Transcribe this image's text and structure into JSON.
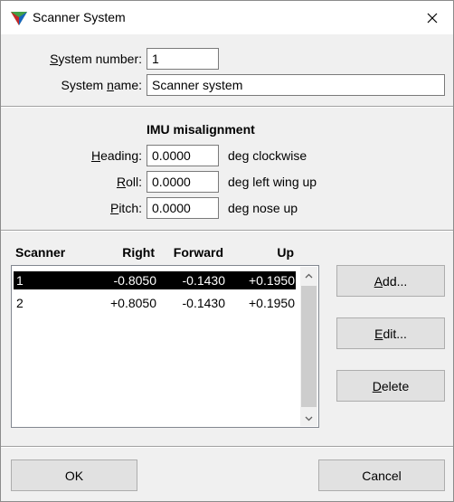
{
  "window": {
    "title": "Scanner System"
  },
  "system": {
    "number_label_pre": "",
    "number_label_u": "S",
    "number_label_post": "ystem number:",
    "number_value": "1",
    "name_label_pre": "System ",
    "name_label_u": "n",
    "name_label_post": "ame:",
    "name_value": "Scanner system"
  },
  "imu": {
    "heading": "IMU misalignment",
    "heading_label_u": "H",
    "heading_label_post": "eading:",
    "heading_value": "0.0000",
    "heading_unit": "deg clockwise",
    "roll_label_u": "R",
    "roll_label_post": "oll:",
    "roll_value": "0.0000",
    "roll_unit": "deg left wing up",
    "pitch_label_u": "P",
    "pitch_label_post": "itch:",
    "pitch_value": "0.0000",
    "pitch_unit": "deg nose up"
  },
  "scanners": {
    "columns": [
      "Scanner",
      "Right",
      "Forward",
      "Up"
    ],
    "rows": [
      {
        "scanner": "1",
        "right": "-0.8050",
        "forward": "-0.1430",
        "up": "+0.1950"
      },
      {
        "scanner": "2",
        "right": "+0.8050",
        "forward": "-0.1430",
        "up": "+0.1950"
      }
    ]
  },
  "buttons": {
    "add_u": "A",
    "add_post": "dd...",
    "edit_u": "E",
    "edit_post": "dit...",
    "delete_u": "D",
    "delete_post": "elete",
    "ok": "OK",
    "cancel": "Cancel"
  }
}
